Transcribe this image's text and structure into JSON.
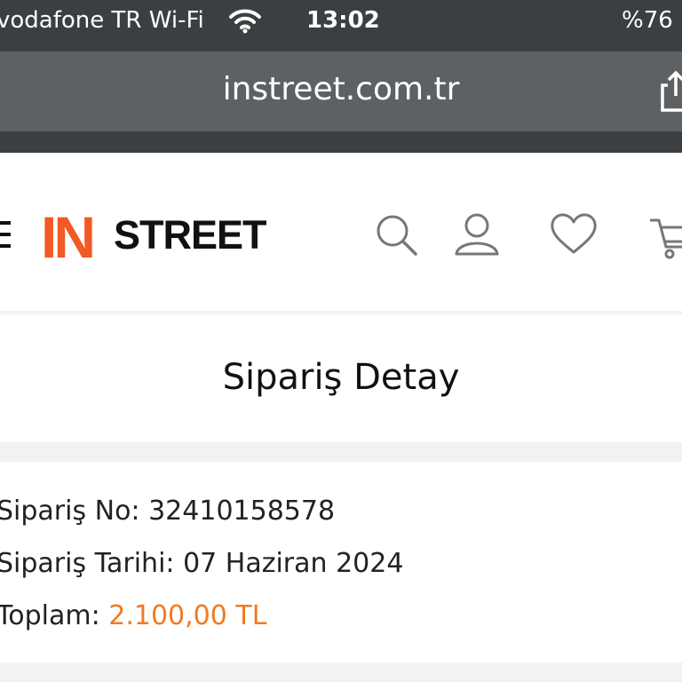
{
  "status_bar": {
    "carrier": "vodafone TR Wi-Fi",
    "time": "13:02",
    "battery": "%76"
  },
  "browser": {
    "url": "instreet.com.tr"
  },
  "site": {
    "logo_in": "IN",
    "logo_street": "STREET",
    "brand_color": "#f15a22",
    "icons": [
      "menu-icon",
      "search-icon",
      "user-icon",
      "heart-icon",
      "cart-icon"
    ]
  },
  "page": {
    "title": "Sipariş Detay"
  },
  "order": {
    "number_label": "Sipariş No:",
    "number_value": "32410158578",
    "date_label": "Sipariş Tarihi:",
    "date_value": "07 Haziran 2024",
    "total_label": "Toplam:",
    "total_value": "2.100,00 TL",
    "total_color": "#f07a22"
  }
}
